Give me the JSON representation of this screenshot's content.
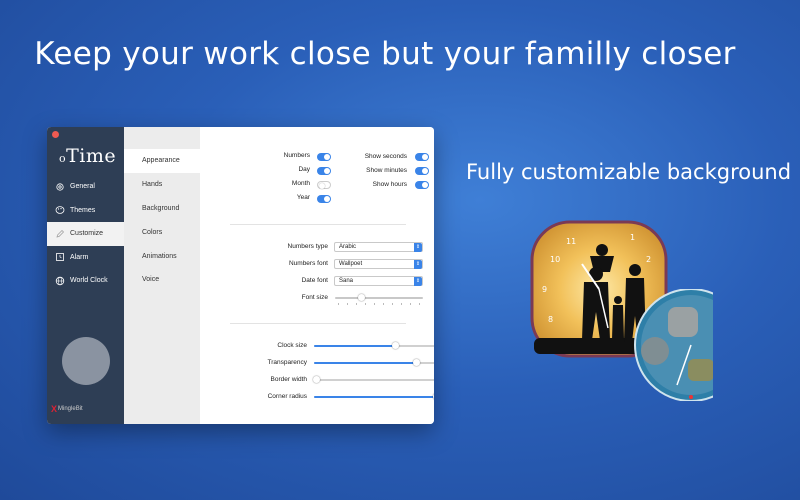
{
  "headline": "Keep your work close but your familly closer",
  "subhead": "Fully customizable background",
  "app": {
    "logo_prefix": "o",
    "logo_text": "Time",
    "brand_mark": "X",
    "brand_text": "MingleBit"
  },
  "sidebar": {
    "items": [
      {
        "label": "General",
        "icon": "gear-icon"
      },
      {
        "label": "Themes",
        "icon": "palette-icon"
      },
      {
        "label": "Customize",
        "icon": "edit-icon"
      },
      {
        "label": "Alarm",
        "icon": "alarm-icon"
      },
      {
        "label": "World Clock",
        "icon": "globe-icon"
      }
    ],
    "active": "Customize"
  },
  "subnav": {
    "items": [
      "Appearance",
      "Hands",
      "Background",
      "Colors",
      "Animations",
      "Voice"
    ],
    "active": "Appearance"
  },
  "appearance": {
    "toggles_left": [
      {
        "label": "Numbers",
        "on": true
      },
      {
        "label": "Day",
        "on": true
      },
      {
        "label": "Month",
        "on": false
      },
      {
        "label": "Year",
        "on": true
      }
    ],
    "toggles_right": [
      {
        "label": "Show seconds",
        "on": true
      },
      {
        "label": "Show minutes",
        "on": true
      },
      {
        "label": "Show hours",
        "on": true
      }
    ],
    "numbers_type_label": "Numbers type",
    "numbers_type_value": "Arabic",
    "numbers_font_label": "Numbers font",
    "numbers_font_value": "Wallpoet",
    "date_font_label": "Date font",
    "date_font_value": "Sana",
    "font_size_label": "Font size",
    "font_size_value": 0.3,
    "sliders": [
      {
        "label": "Clock size",
        "value": 0.65
      },
      {
        "label": "Transparency",
        "value": 0.82
      },
      {
        "label": "Border width",
        "value": 0.02
      },
      {
        "label": "Corner radius",
        "value": 0.98
      }
    ]
  },
  "colors": {
    "accent": "#3a84e8",
    "sidebar_bg": "#2e3e55",
    "close": "#ee5a52"
  }
}
